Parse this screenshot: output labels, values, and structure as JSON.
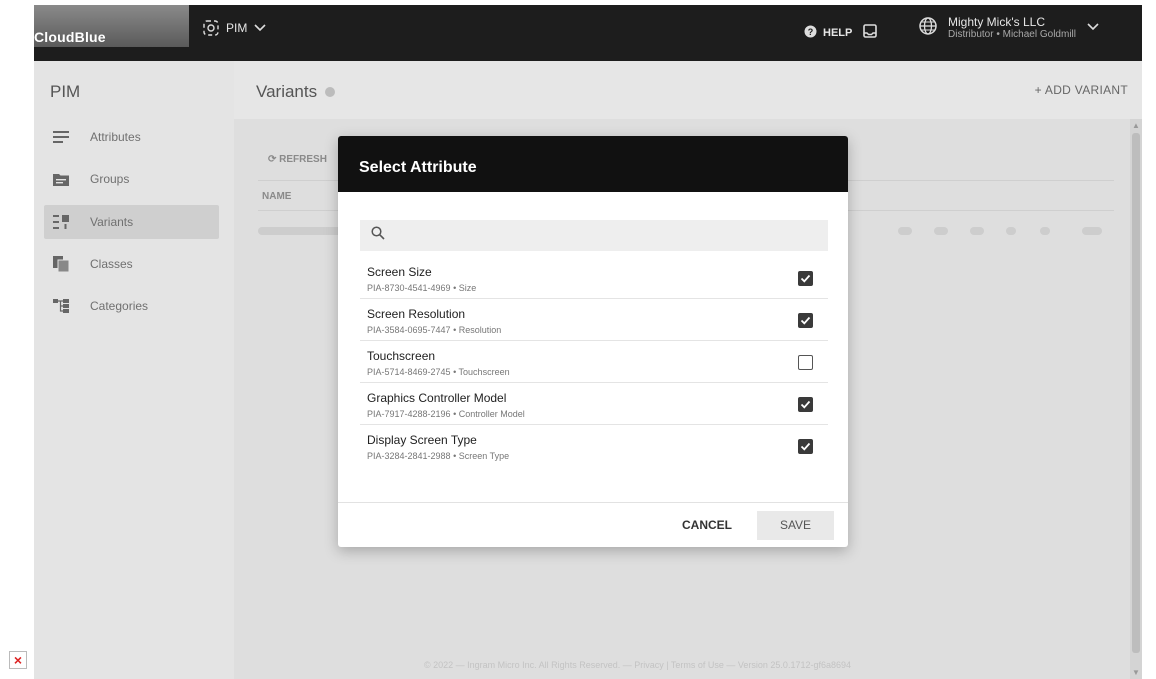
{
  "header": {
    "logo_text": "CloudBlue",
    "module_label": "PIM",
    "help_label": "HELP",
    "account_name": "Mighty Mick's LLC",
    "account_role": "Distributor • Michael Goldmill"
  },
  "sidebar": {
    "title": "PIM",
    "items": [
      {
        "label": "Attributes",
        "icon": "list-lines-icon"
      },
      {
        "label": "Groups",
        "icon": "folder-icon"
      },
      {
        "label": "Variants",
        "icon": "variants-icon"
      },
      {
        "label": "Classes",
        "icon": "copy-files-icon"
      },
      {
        "label": "Categories",
        "icon": "tree-icon"
      }
    ],
    "active_index": 2
  },
  "main": {
    "title": "Variants",
    "add_label": "+ ADD VARIANT",
    "refresh_label": "⟳ REFRESH",
    "column_name": "NAME",
    "footer": "© 2022 — Ingram Micro Inc. All Rights Reserved. — Privacy | Terms of Use — Version 25.0.1712-gf6a8694"
  },
  "modal": {
    "title": "Select Attribute",
    "search_placeholder": "",
    "items": [
      {
        "title": "Screen Size",
        "subtitle": "PIA-8730-4541-4969 • Size",
        "checked": true
      },
      {
        "title": "Screen Resolution",
        "subtitle": "PIA-3584-0695-7447 • Resolution",
        "checked": true
      },
      {
        "title": "Touchscreen",
        "subtitle": "PIA-5714-8469-2745 • Touchscreen",
        "checked": false
      },
      {
        "title": "Graphics Controller Model",
        "subtitle": "PIA-7917-4288-2196 • Controller Model",
        "checked": true
      },
      {
        "title": "Display Screen Type",
        "subtitle": "PIA-3284-2841-2988 • Screen Type",
        "checked": true
      }
    ],
    "cancel_label": "CANCEL",
    "save_label": "SAVE"
  },
  "colors": {
    "header_bg": "#1d1d1d",
    "overlay": "#e6e6e6",
    "modal_header_bg": "#111111"
  }
}
